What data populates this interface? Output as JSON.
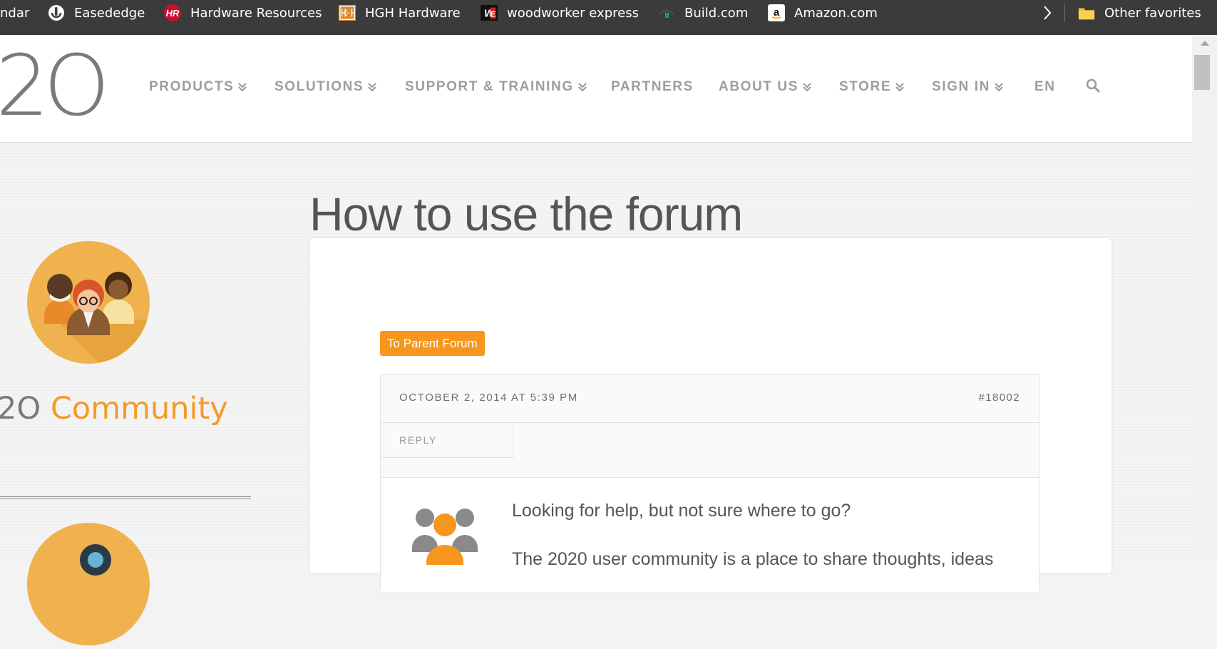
{
  "bookmarks": {
    "items": [
      {
        "label": "ndar",
        "icon": "partial-bookmark"
      },
      {
        "label": "Easededge",
        "icon": "easededge-logo-icon"
      },
      {
        "label": "Hardware Resources",
        "icon": "hr-logo-icon"
      },
      {
        "label": "HGH Hardware",
        "icon": "hgh-logo-icon"
      },
      {
        "label": "woodworker express",
        "icon": "we-logo-icon"
      },
      {
        "label": "Build.com",
        "icon": "build-logo-icon"
      },
      {
        "label": "Amazon.com",
        "icon": "amazon-logo-icon"
      }
    ],
    "overflow_icon": "chevron-right-icon",
    "other_favorites": "Other favorites",
    "colors": {
      "bar": "#3b3b3b",
      "text": "#ffffff"
    }
  },
  "header": {
    "logo_text": "2O",
    "nav": [
      {
        "label": "PRODUCTS",
        "has_dropdown": true
      },
      {
        "label": "SOLUTIONS",
        "has_dropdown": true
      },
      {
        "label": "SUPPORT & TRAINING",
        "has_dropdown": true
      },
      {
        "label": "PARTNERS",
        "has_dropdown": false
      },
      {
        "label": "ABOUT US",
        "has_dropdown": true
      },
      {
        "label": "STORE",
        "has_dropdown": true
      },
      {
        "label": "SIGN IN",
        "has_dropdown": true
      },
      {
        "label": "EN",
        "has_dropdown": false
      }
    ],
    "search_icon": "search-icon",
    "colors": {
      "nav_text": "#9d9d9d"
    }
  },
  "sidebar": {
    "community_prefix": "2O",
    "community_label": "Community",
    "colors": {
      "accent": "#f39a2a",
      "avatar_bg": "#f0b24e"
    }
  },
  "main": {
    "title": "How to use the forum",
    "parent_forum_button": "To Parent Forum",
    "post": {
      "date": "OCTOBER 2, 2014 AT 5:39 PM",
      "id": "#18002",
      "reply": "REPLY",
      "heading": "Looking for help, but not sure where to go?",
      "text": "The 2020 user community is a place to share thoughts, ideas"
    },
    "colors": {
      "button": "#f7961d",
      "title": "#555555"
    }
  }
}
